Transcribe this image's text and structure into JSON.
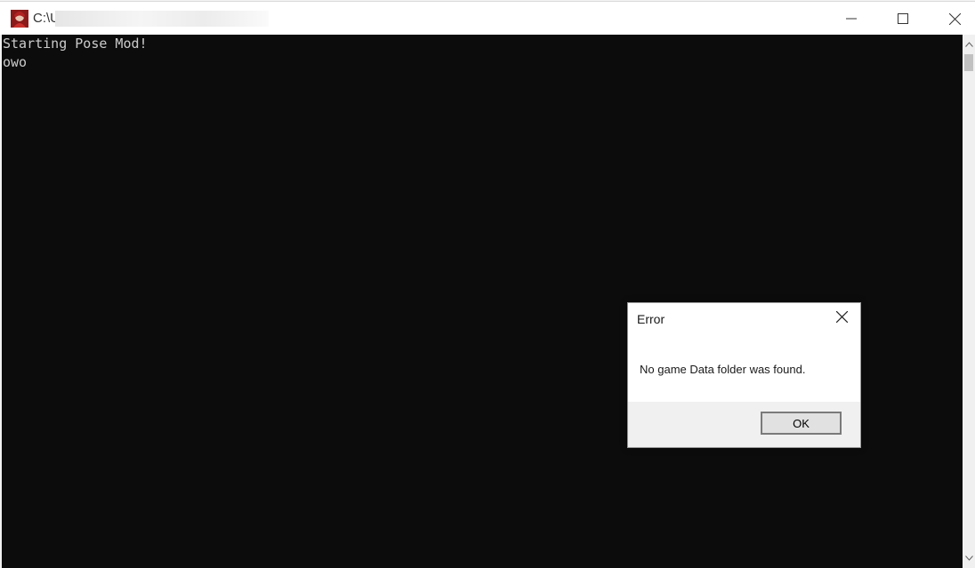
{
  "window": {
    "title": "C:\\U",
    "controls": {
      "minimize_icon": "minimize-icon",
      "maximize_icon": "maximize-icon",
      "close_icon": "close-icon"
    }
  },
  "console": {
    "lines": [
      "Starting Pose Mod!",
      "owo"
    ],
    "background": "#0c0c0c",
    "text_color": "#cccccc"
  },
  "dialog": {
    "title": "Error",
    "message": "No game Data folder was found.",
    "ok_label": "OK"
  },
  "scrollbar": {
    "up_icon": "chevron-up-icon",
    "down_icon": "chevron-down-icon"
  }
}
